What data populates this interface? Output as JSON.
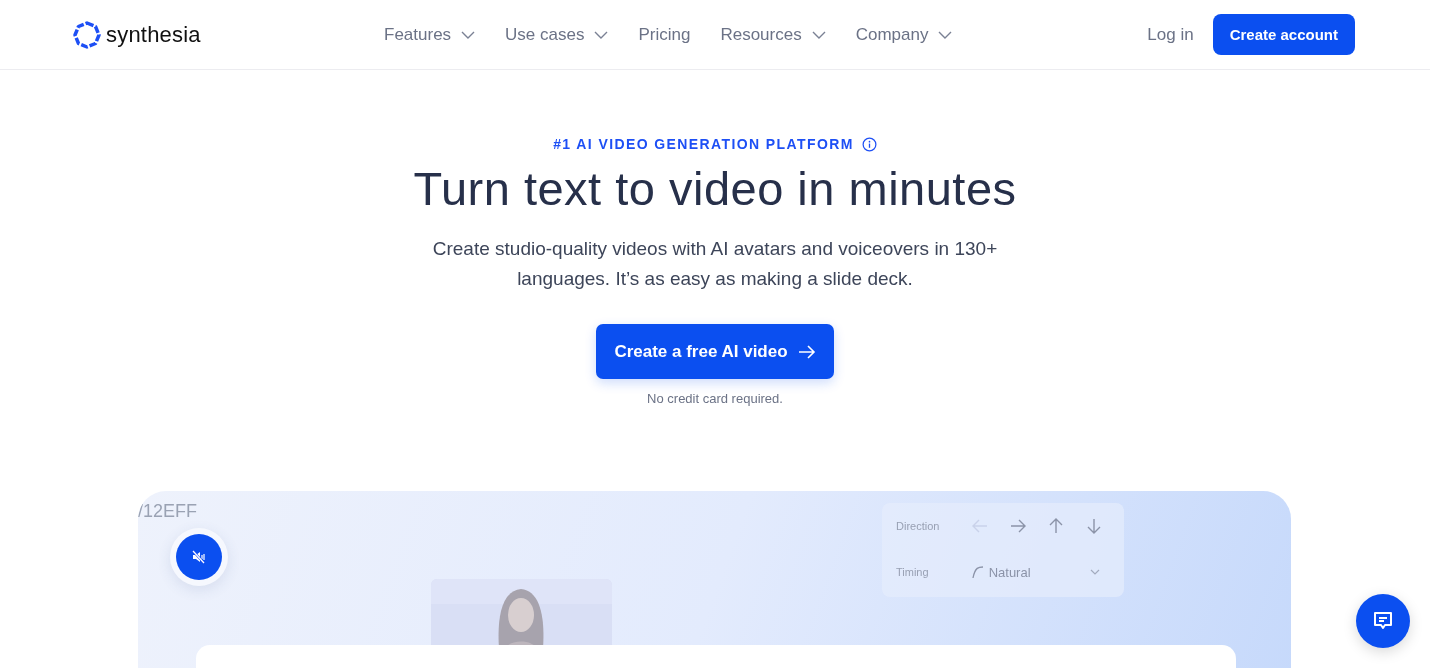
{
  "nav": {
    "logo": "synthesia",
    "links": [
      {
        "label": "Features",
        "dropdown": true
      },
      {
        "label": "Use cases",
        "dropdown": true
      },
      {
        "label": "Pricing",
        "dropdown": false
      },
      {
        "label": "Resources",
        "dropdown": true
      },
      {
        "label": "Company",
        "dropdown": true
      }
    ],
    "login": "Log in",
    "cta": "Create account"
  },
  "hero": {
    "eyebrow": "#1 AI VIDEO GENERATION PLATFORM",
    "title": "Turn text to video in minutes",
    "subtitle": "Create studio-quality videos with AI avatars and voiceovers in 130+ languages. It’s as easy as making a slide deck.",
    "cta": "Create a free AI video",
    "note": "No credit card required."
  },
  "demo": {
    "code_fragment": "/12EFF",
    "muted": true,
    "settings": [
      {
        "kind": "arrows",
        "label": "Direction",
        "arrows": [
          {
            "kind": "left",
            "disabled": true
          },
          {
            "kind": "right",
            "disabled": false
          },
          {
            "kind": "up",
            "disabled": false
          },
          {
            "kind": "down",
            "disabled": false
          }
        ]
      },
      {
        "kind": "select",
        "label": "Timing",
        "value": "Natural"
      }
    ]
  }
}
